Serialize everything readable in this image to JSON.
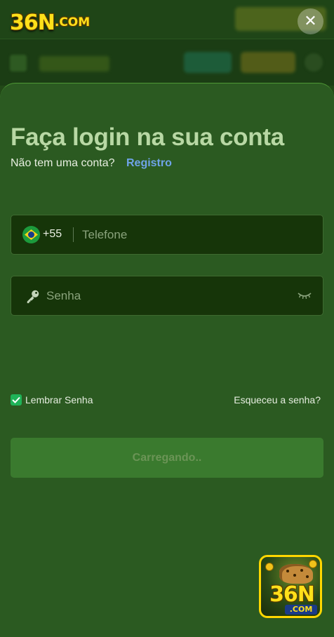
{
  "logo": {
    "main": "36N",
    "com": ".COM"
  },
  "close": {
    "glyph": "✕"
  },
  "login": {
    "title": "Faça login na sua conta",
    "no_account": "Não tem uma conta?",
    "register_link": "Registro"
  },
  "phone": {
    "country_code": "+55",
    "placeholder": "Telefone",
    "value": ""
  },
  "password": {
    "placeholder": "Senha",
    "value": ""
  },
  "remember": {
    "label": "Lembrar Senha",
    "checked": true
  },
  "forgot": {
    "label": "Esqueceu a senha?"
  },
  "submit": {
    "label": "Carregando.."
  },
  "floating_logo": {
    "main": "36N",
    "com": ".COM"
  },
  "colors": {
    "sheet_bg": "#2b5a21",
    "input_bg": "#163509",
    "link": "#6fa3e8",
    "checkbox": "#1fb358",
    "logo_yellow": "#ffe01a"
  },
  "icons": [
    "close-icon",
    "brazil-flag-icon",
    "key-icon",
    "eye-closed-icon",
    "check-icon"
  ]
}
